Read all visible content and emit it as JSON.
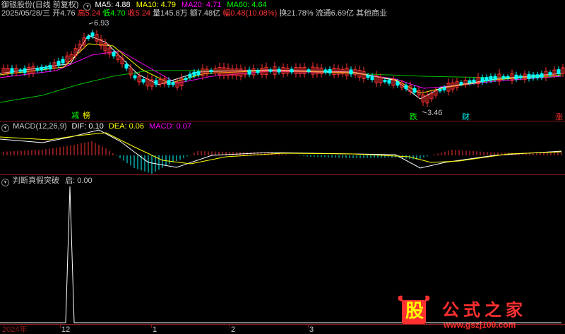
{
  "header": {
    "title": "御银股份(日线 前复权)",
    "ma_labels": [
      {
        "label": "MA5: 4.88",
        "color": "#ffffff"
      },
      {
        "label": "MA10: 4.79",
        "color": "#ffff00"
      },
      {
        "label": "MA20: 4.71",
        "color": "#ff00ff"
      },
      {
        "label": "MA60: 4.64",
        "color": "#00ff00"
      }
    ]
  },
  "info_row": [
    {
      "text": "2025/05/28/三",
      "color": "#c8c8c8"
    },
    {
      "text": "开4.76",
      "color": "#c8c8c8"
    },
    {
      "text": "高5.24",
      "color": "#ff3232"
    },
    {
      "text": "低4.70",
      "color": "#00ff00"
    },
    {
      "text": "收5.24",
      "color": "#ff3232"
    },
    {
      "text": "量145.8万",
      "color": "#c8c8c8"
    },
    {
      "text": "额7.48亿",
      "color": "#c8c8c8"
    },
    {
      "text": "幅0.48(10.08%)",
      "color": "#ff3232"
    },
    {
      "text": "换21.78%",
      "color": "#c8c8c8"
    },
    {
      "text": "流通6.69亿",
      "color": "#c8c8c8"
    },
    {
      "text": "其他商业",
      "color": "#c8c8c8"
    }
  ],
  "price_annotations": {
    "high": "6.93",
    "low": "3.46"
  },
  "event_markers": [
    "减",
    "榜",
    "跌",
    "财",
    "涨"
  ],
  "macd": {
    "title": "MACD(12,26,9)",
    "dif": "DIF: 0.10",
    "dea": "DEA: 0.06",
    "macd": "MACD: 0.07",
    "dif_color": "#ffffff",
    "dea_color": "#ffff00",
    "macd_color": "#ff00ff"
  },
  "signal": {
    "title": "判断真假突破",
    "value": "启: 0.00"
  },
  "x_axis": [
    "2024年",
    "12",
    "1",
    "2",
    "3"
  ],
  "watermark": {
    "logo_char": "股",
    "brand": "公式之家",
    "url": "www.gszj100.com"
  },
  "colors": {
    "up": "#ff3232",
    "down": "#00ffff",
    "border": "#8b1a1a"
  }
}
